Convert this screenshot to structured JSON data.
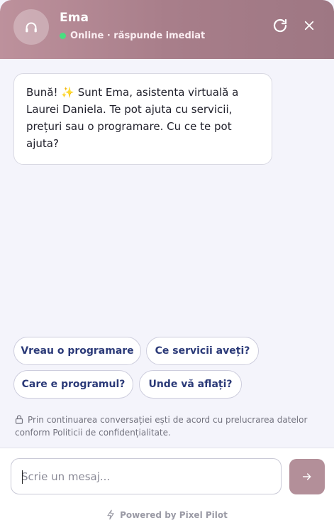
{
  "header": {
    "name": "Ema",
    "status": "Online · răspunde imediat",
    "status_color": "#4ade80",
    "avatar_icon": "headphones-icon",
    "refresh_icon": "refresh-icon",
    "close_icon": "close-icon",
    "gradient": [
      "#bd919c",
      "#9e7783"
    ]
  },
  "messages": [
    {
      "from": "bot",
      "text": "Bună! ✨ Sunt Ema, asistenta virtuală a Laurei Daniela. Te pot ajuta cu servicii, prețuri sau o programare. Cu ce te pot ajuta?"
    }
  ],
  "quick_replies": [
    "Vreau o programare",
    "Ce servicii aveți?",
    "Care e programul?",
    "Unde vă aflați?"
  ],
  "privacy": {
    "icon": "lock-icon",
    "text": "Prin continuarea conversației ești de acord cu prelucrarea datelor conform Politicii de confidențialitate."
  },
  "composer": {
    "placeholder": "Scrie un mesaj...",
    "value": "",
    "send_icon": "arrow-right-icon",
    "accent": "#b38f99"
  },
  "branding": {
    "icon": "bolt-icon",
    "text": "Powered by Pixel Pilot"
  }
}
